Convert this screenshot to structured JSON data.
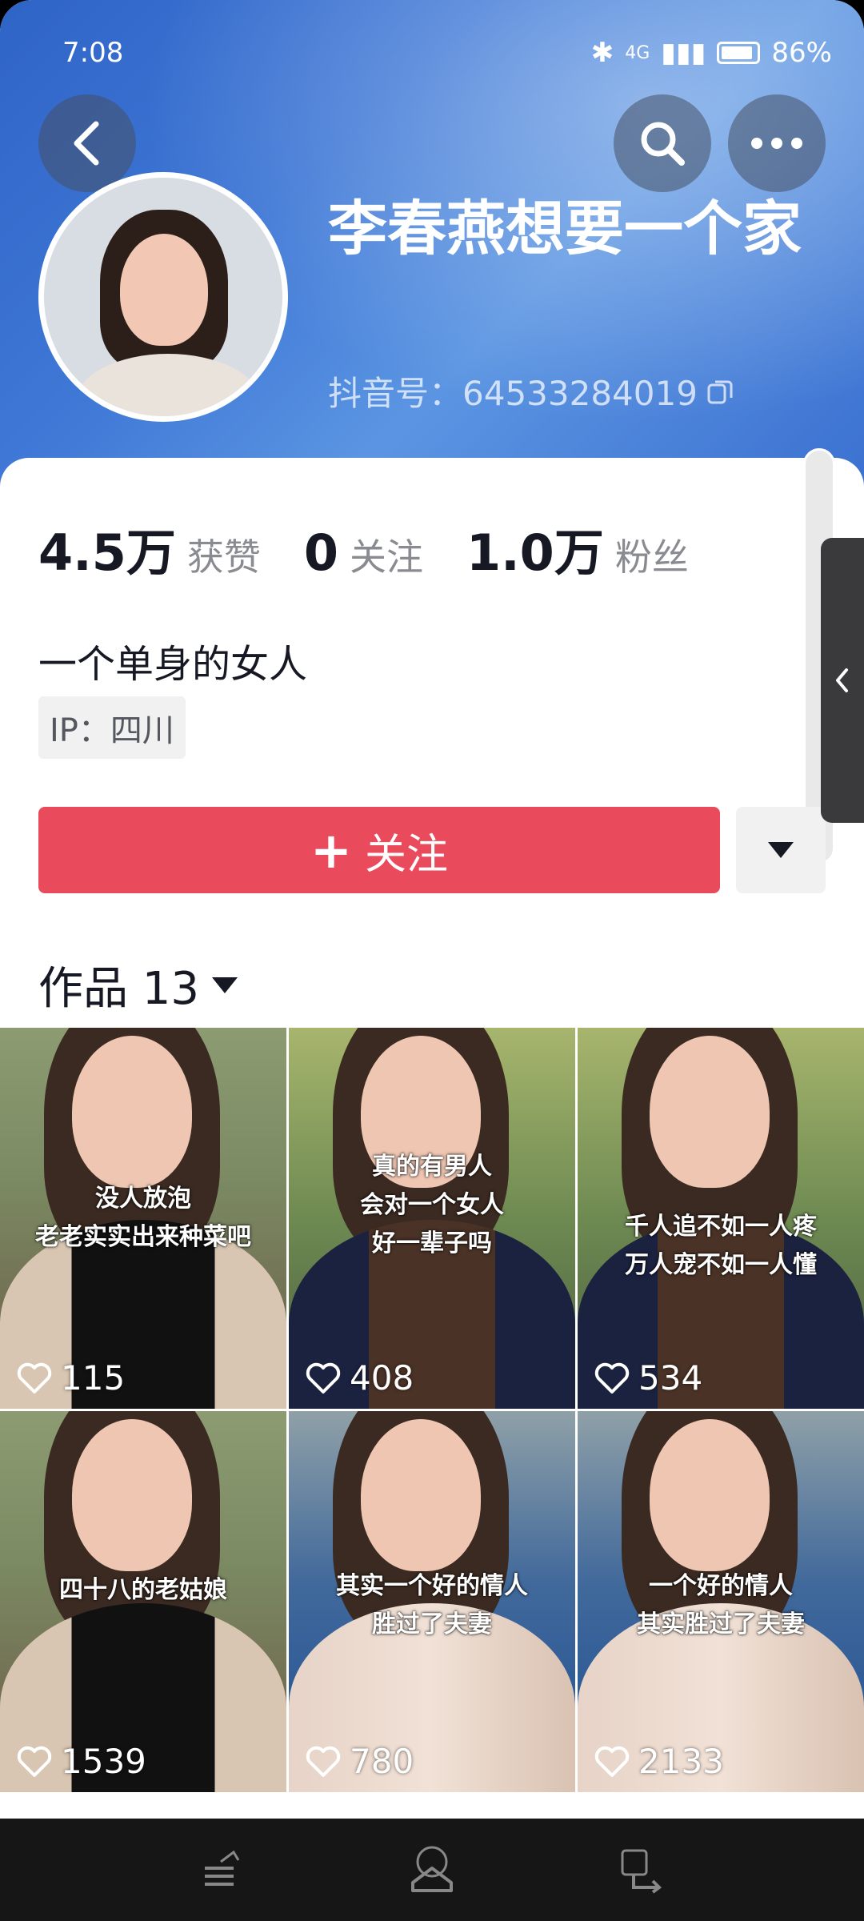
{
  "status_bar": {
    "time": "7:08",
    "battery": "86%",
    "network": "4G"
  },
  "profile": {
    "name": "李春燕想要一个家",
    "douyin_id": "抖音号：64533284019",
    "bio": "一个单身的女人",
    "ip": "IP：四川"
  },
  "stats": [
    {
      "value": "4.5万",
      "label": "获赞"
    },
    {
      "value": "0",
      "label": "关注"
    },
    {
      "value": "1.0万",
      "label": "粉丝"
    }
  ],
  "actions": {
    "follow_label": "关注",
    "follow_plus": "+"
  },
  "works": {
    "title": "作品 13"
  },
  "videos": [
    {
      "caption": "没人放泡\n老老实实出来种菜吧",
      "likes": "115"
    },
    {
      "caption": "真的有男人\n会对一个女人\n好一辈子吗",
      "likes": "408"
    },
    {
      "caption": "千人追不如一人疼\n万人宠不如一人懂",
      "likes": "534"
    },
    {
      "caption": "四十八的老姑娘",
      "likes": "1539"
    },
    {
      "caption": "其实一个好的情人\n胜过了夫妻",
      "likes": "780"
    },
    {
      "caption": "一个好的情人\n其实胜过了夫妻",
      "likes": "2133"
    }
  ],
  "colors": {
    "header_blue": "#3f78d6",
    "follow_red": "#e94a5c"
  },
  "icons": [
    "back-icon",
    "search-icon",
    "more-icon",
    "copy-icon",
    "heart-icon",
    "menu-icon",
    "home-icon",
    "return-icon"
  ]
}
